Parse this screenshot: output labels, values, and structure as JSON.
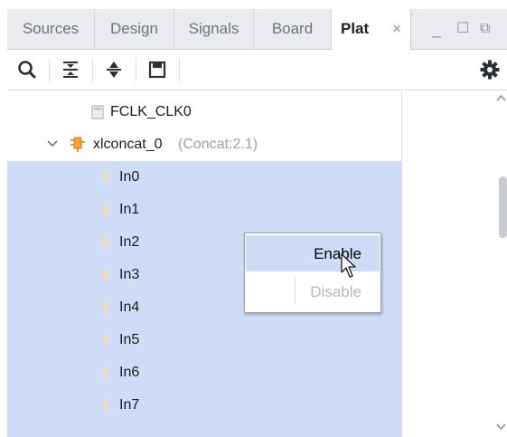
{
  "tabs": [
    {
      "label": "Sources"
    },
    {
      "label": "Design"
    },
    {
      "label": "Signals"
    },
    {
      "label": "Board"
    },
    {
      "label": "Plat",
      "active": true,
      "close": "×"
    }
  ],
  "window_controls": {
    "minimize": "_",
    "maximize": "☐",
    "restore": "⧉"
  },
  "toolbar": {
    "icons": [
      "search-icon",
      "collapse-all-icon",
      "expand-all-icon",
      "save-icon",
      "gear-icon"
    ]
  },
  "tree": {
    "rows": [
      {
        "label": "FCLK_CLK0",
        "icon": "pin-icon",
        "selected": false
      },
      {
        "label": "xlconcat_0",
        "suffix": "(Concat:2.1)",
        "icon": "ip-block-icon",
        "expander": "chevron-down-icon",
        "selected": false
      },
      {
        "label": "In0",
        "icon": "pin-icon",
        "selected": true
      },
      {
        "label": "In1",
        "icon": "pin-icon",
        "selected": true
      },
      {
        "label": "In2",
        "icon": "pin-icon",
        "selected": true
      },
      {
        "label": "In3",
        "icon": "pin-icon",
        "selected": true
      },
      {
        "label": "In4",
        "icon": "pin-icon",
        "selected": true
      },
      {
        "label": "In5",
        "icon": "pin-icon",
        "selected": true
      },
      {
        "label": "In6",
        "icon": "pin-icon",
        "selected": true
      },
      {
        "label": "In7",
        "icon": "pin-icon",
        "selected": true
      }
    ]
  },
  "context_menu": {
    "items": [
      {
        "label": "Enable",
        "enabled": true,
        "hovered": true
      },
      {
        "label": "Disable",
        "enabled": false
      }
    ]
  },
  "colors": {
    "selection": "#cfdcf7",
    "accent_edge": "#4a73c8",
    "disabled_text": "#b4b8be"
  }
}
